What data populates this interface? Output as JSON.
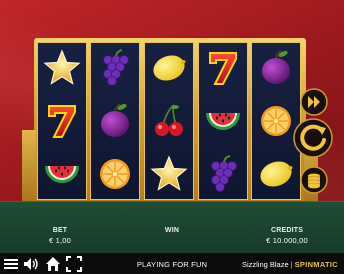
{
  "game": {
    "title": "Sizzling Blaze",
    "provider": "SPINMATIC",
    "mode_text": "PLAYING FOR FUN"
  },
  "stats": {
    "bet_label": "BET",
    "bet_value": "€ 1,00",
    "win_label": "WIN",
    "win_value": "",
    "credits_label": "CREDITS",
    "credits_value": "€ 10.000,00"
  },
  "reels": [
    [
      "star",
      "seven",
      "watermelon"
    ],
    [
      "grapes",
      "plum",
      "orange"
    ],
    [
      "lemon",
      "cherries",
      "star"
    ],
    [
      "seven",
      "watermelon",
      "grapes"
    ],
    [
      "plum",
      "orange",
      "lemon"
    ]
  ],
  "controls": {
    "fast_forward": "fast-forward-icon",
    "spin": "spin-icon",
    "coins": "coin-stack-icon",
    "menu": "menu-icon",
    "sound": "speaker-icon",
    "home": "home-icon",
    "fullscreen": "fullscreen-icon"
  },
  "colors": {
    "background": "#a81d21",
    "reel_bg": "#151c3b",
    "frame_gold": "#d9a63a",
    "panel_green": "#1d4a33",
    "bar_black": "#0b0b0b",
    "brand_gold": "#e7c34a"
  }
}
